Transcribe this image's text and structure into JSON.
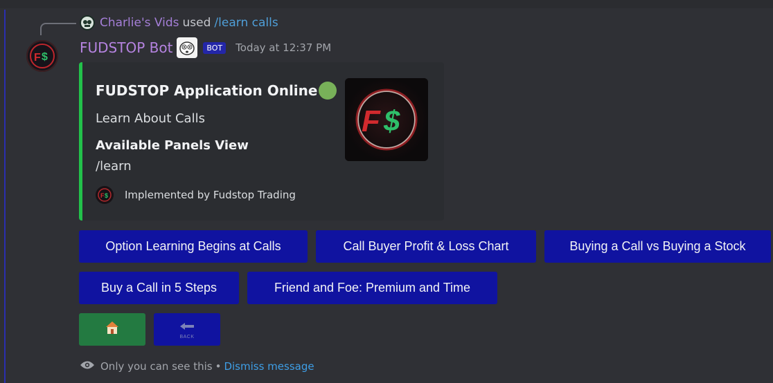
{
  "reply": {
    "user": "Charlie's Vids",
    "used": "used",
    "command": "/learn calls"
  },
  "message": {
    "author": "FUDSTOP Bot",
    "bot_tag": "BOT",
    "timestamp": "Today at 12:37 PM"
  },
  "embed": {
    "title": "FUDSTOP Application Online",
    "description": "Learn About Calls",
    "field_name": "Available Panels View",
    "field_value": "/learn",
    "footer": "Implemented by Fudstop Trading",
    "accent_color": "#22c14a"
  },
  "buttons": {
    "b1": "Option Learning Begins at Calls",
    "b2": "Call Buyer Profit & Loss Chart",
    "b3": "Buying a Call vs Buying a Stock",
    "b4": "Buy a Call in 5 Steps",
    "b5": "Friend and Foe: Premium and Time",
    "home_icon": "house-emoji",
    "back_icon": "back-arrow",
    "back_label": "BACK"
  },
  "ephemeral": {
    "text": "Only you can see this",
    "separator": "•",
    "dismiss": "Dismiss message"
  },
  "colors": {
    "button": "#1013a0",
    "green_button": "#237a41",
    "author": "#b583e0",
    "link": "#3e9ee6"
  }
}
